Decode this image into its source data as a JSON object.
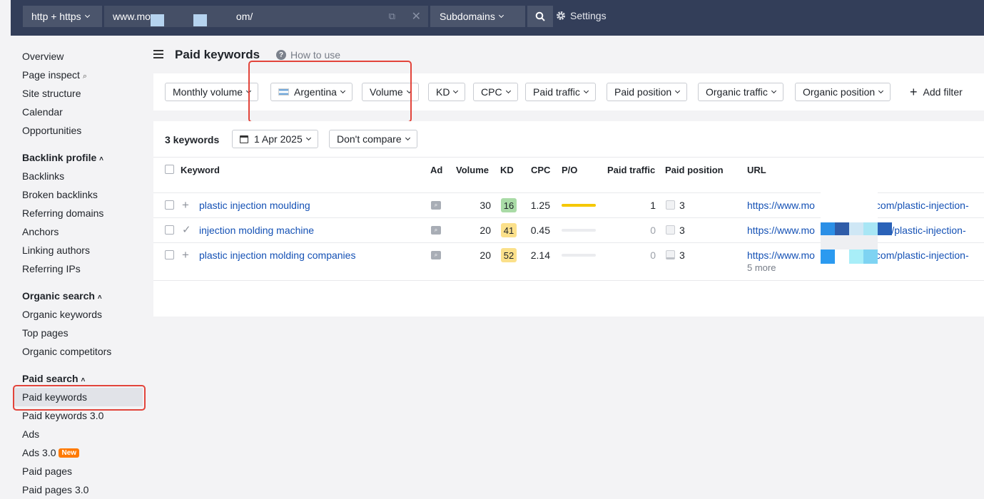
{
  "topbar": {
    "protocol": "http + https",
    "url_start": "www.mo",
    "url_end": "om/",
    "mode": "Subdomains",
    "settings": "Settings"
  },
  "sidebar": {
    "items_top": [
      "Overview",
      "Page inspect",
      "Site structure",
      "Calendar",
      "Opportunities"
    ],
    "backlink_header": "Backlink profile",
    "backlink_items": [
      "Backlinks",
      "Broken backlinks",
      "Referring domains",
      "Anchors",
      "Linking authors",
      "Referring IPs"
    ],
    "organic_header": "Organic search",
    "organic_items": [
      "Organic keywords",
      "Top pages",
      "Organic competitors"
    ],
    "paid_header": "Paid search",
    "paid_items": [
      "Paid keywords",
      "Paid keywords 3.0",
      "Ads",
      "Ads 3.0",
      "Paid pages",
      "Paid pages 3.0"
    ],
    "new_badge": "New"
  },
  "page": {
    "title": "Paid keywords",
    "how_to_use": "How to use"
  },
  "filters": {
    "monthly_volume": "Monthly volume",
    "country": "Argentina",
    "volume": "Volume",
    "kd": "KD",
    "cpc": "CPC",
    "paid_traffic": "Paid traffic",
    "paid_position": "Paid position",
    "organic_traffic": "Organic traffic",
    "organic_position": "Organic position",
    "add_filter": "Add filter"
  },
  "results": {
    "count": "3 keywords",
    "date": "1 Apr 2025",
    "compare": "Don't compare",
    "columns": {
      "keyword": "Keyword",
      "ad": "Ad",
      "volume": "Volume",
      "kd": "KD",
      "cpc": "CPC",
      "po": "P/O",
      "paid_traffic": "Paid traffic",
      "paid_position": "Paid position",
      "url": "URL"
    },
    "rows": [
      {
        "keyword": "plastic injection moulding",
        "volume": "30",
        "kd": "16",
        "kd_color": "#a9dba6",
        "cpc": "1.25",
        "po_fill": 1.0,
        "po_color": "#f5c800",
        "paid_traffic": "1",
        "position": "3",
        "url_start": "https://www.mo",
        "url_end": "l.com/plastic-injection-"
      },
      {
        "keyword": "injection molding machine",
        "volume": "20",
        "kd": "41",
        "kd_color": "#fbe08a",
        "cpc": "0.45",
        "po_fill": 0,
        "po_color": "#ebecef",
        "paid_traffic": "0",
        "position": "3",
        "url_start": "https://www.mo",
        "url_end": "om/plastic-injection-"
      },
      {
        "keyword": "plastic injection molding companies",
        "volume": "20",
        "kd": "52",
        "kd_color": "#fbe08a",
        "cpc": "2.14",
        "po_fill": 0,
        "po_color": "#ebecef",
        "paid_traffic": "0",
        "position": "3",
        "url_start": "https://www.mo",
        "url_end": "l.com/plastic-injection-"
      }
    ],
    "more": "5 more"
  }
}
